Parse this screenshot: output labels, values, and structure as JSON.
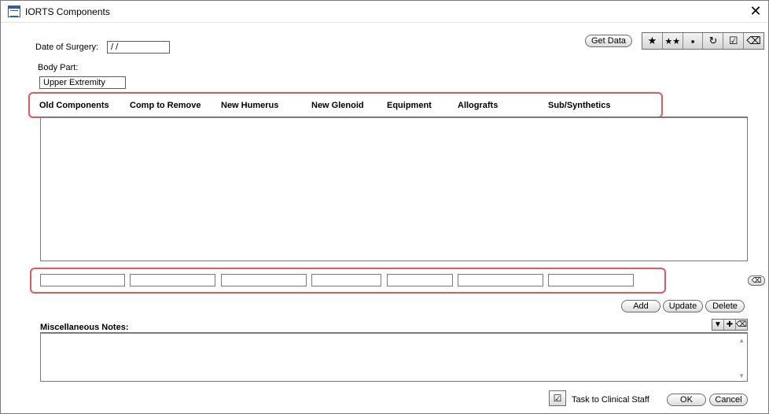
{
  "window": {
    "title": "IORTS Components",
    "close_glyph": "✕"
  },
  "form": {
    "date_label": "Date of Surgery:",
    "date_value": " /  /",
    "body_part_label": "Body Part:",
    "body_part_value": "Upper Extremity"
  },
  "buttons": {
    "get_data": "Get Data",
    "add": "Add",
    "update": "Update",
    "delete": "Delete",
    "ok": "OK",
    "cancel": "Cancel",
    "task_label": "Task to Clinical Staff"
  },
  "toolbar": {
    "icons": [
      "star-icon",
      "double-star-icon",
      "save-icon",
      "refresh-icon",
      "clipboard-check-icon",
      "eraser-icon"
    ],
    "glyphs": [
      "★",
      "★★",
      "▪",
      "↻",
      "☑",
      "⌫"
    ]
  },
  "columns": [
    "Old Components",
    "Comp to Remove",
    "New Humerus",
    "New Glenoid",
    "Equipment",
    "Allografts",
    "Sub/Synthetics"
  ],
  "notes": {
    "label": "Miscellaneous Notes:",
    "tool_glyphs": [
      "▼",
      "✚",
      "⌫"
    ]
  }
}
